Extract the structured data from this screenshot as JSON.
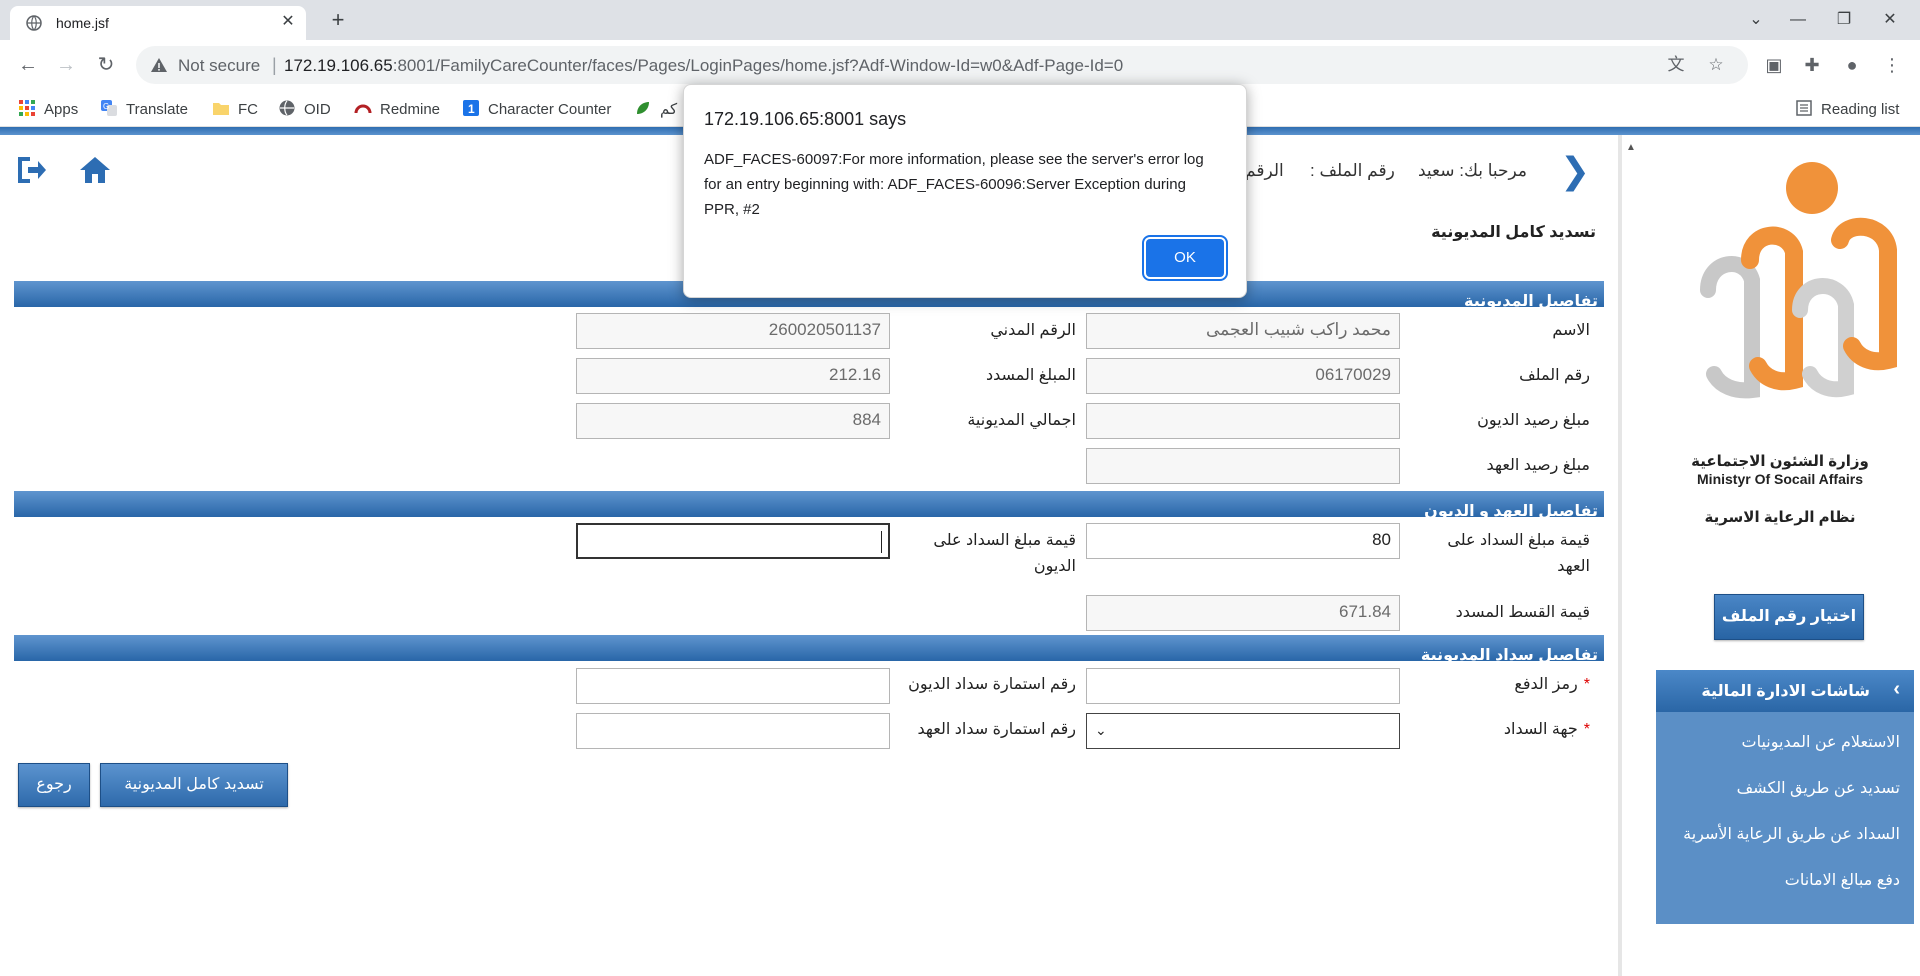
{
  "browser": {
    "tab_title": "home.jsf",
    "url_security": "Not secure",
    "url_host": "172.19.106.65",
    "url_rest": ":8001/FamilyCareCounter/faces/Pages/LoginPages/home.jsf?Adf-Window-Id=w0&Adf-Page-Id=0",
    "bookmarks": [
      "Apps",
      "Translate",
      "FC",
      "OID",
      "Redmine",
      "Character Counter",
      "كم"
    ],
    "reading_list": "Reading list"
  },
  "header": {
    "welcome": "مرحبا بك: سعيد",
    "file_number_label": "رقم الملف :",
    "civil_label": "الرقم"
  },
  "page": {
    "title": "تسديد كامل المديونية"
  },
  "sections": {
    "debt_details": "تفاصيل المديونية",
    "custody_debts": "تفاصيل العهد و الديون",
    "payment_details": "تفاصيل سداد المديونية"
  },
  "fields": {
    "name_label": "الاسم",
    "name_value": "محمد راكب شبيب العجمى",
    "civil_id_label": "الرقم المدني",
    "civil_id_value": "260020501137",
    "file_no_label": "رقم الملف",
    "file_no_value": "06170029",
    "paid_amount_label": "المبلغ المسدد",
    "paid_amount_value": "212.16",
    "debt_balance_label": "مبلغ رصيد الديون",
    "debt_balance_value": "",
    "total_debt_label": "اجمالي المديونية",
    "total_debt_value": "884",
    "custody_balance_label": "مبلغ رصيد العهد",
    "custody_balance_value": "",
    "custody_pay_label": "قيمة مبلغ السداد على العهد",
    "custody_pay_value": "80",
    "debt_pay_label": "قيمة مبلغ السداد على الديون",
    "debt_pay_value": "",
    "installment_label": "قيمة القسط المسدد",
    "installment_value": "671.84",
    "pay_code_label": "رمز الدفع",
    "pay_code_value": "",
    "debt_form_label": "رقم استمارة سداد الديون",
    "debt_form_value": "",
    "pay_entity_label": "جهة السداد",
    "pay_entity_value": "",
    "custody_form_label": "رقم استمارة سداد العهد",
    "custody_form_value": "",
    "required_mark": "*"
  },
  "buttons": {
    "pay_full": "تسديد كامل المديونية",
    "back": "رجوع"
  },
  "side": {
    "ministry_ar": "وزارة الشئون الاجتماعية",
    "ministry_en": "Ministyr Of Socail Affairs",
    "system_name": "نظام الرعاية الاسرية",
    "choose_file": "اختيار رقم الملف",
    "menu_title": "شاشات الادارة المالية",
    "menu_items": [
      "الاستعلام عن المديونيات",
      "تسديد عن طريق الكشف",
      "السداد عن طريق الرعاية الأسرية",
      "دفع مبالغ الامانات"
    ]
  },
  "dialog": {
    "title": "172.19.106.65:8001 says",
    "message": "ADF_FACES-60097:For more information, please see the server's error log for an entry beginning with: ADF_FACES-60096:Server Exception during PPR, #2",
    "ok_label": "OK"
  },
  "colors": {
    "brand_blue": "#2d6db3",
    "section_blue": "#2966a8",
    "logo_orange": "#f0923a",
    "dialog_button": "#1a73e8"
  }
}
